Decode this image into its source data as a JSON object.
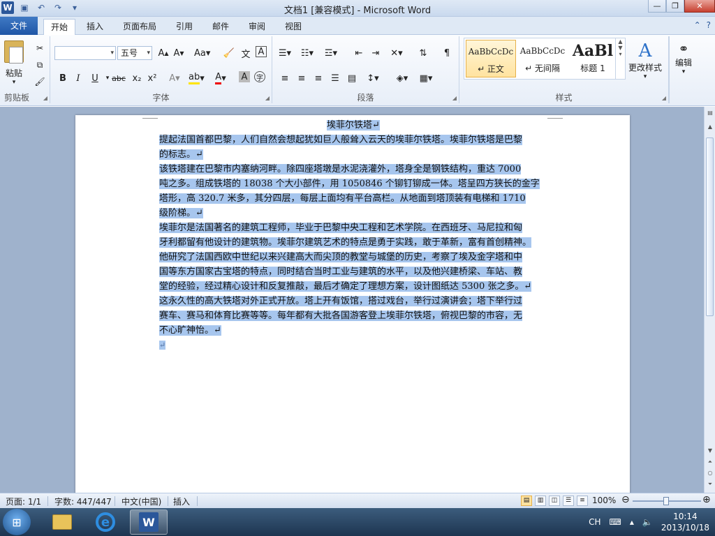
{
  "window": {
    "title": "文档1 [兼容模式] - Microsoft Word",
    "app_letter": "W"
  },
  "ribbon_tabs": [
    "文件",
    "开始",
    "插入",
    "页面布局",
    "引用",
    "邮件",
    "审阅",
    "视图"
  ],
  "ribbon": {
    "clipboard": {
      "paste_label": "粘贴",
      "group_label": "剪贴板"
    },
    "font": {
      "font_name": "",
      "font_size": "五号",
      "group_label": "字体",
      "bold": "B",
      "italic": "I",
      "underline": "U",
      "strikethrough": "abc",
      "subscript": "x₂",
      "superscript": "x²"
    },
    "paragraph": {
      "group_label": "段落"
    },
    "styles": {
      "group_label": "样式",
      "items": [
        {
          "sample": "AaBbCcDc",
          "name": "↵ 正文"
        },
        {
          "sample": "AaBbCcDc",
          "name": "↵ 无间隔"
        },
        {
          "sample": "AaBl",
          "name": "标题 1"
        }
      ],
      "change_styles_label": "更改样式"
    },
    "editing": {
      "label": "编辑"
    }
  },
  "document": {
    "lines": [
      "埃菲尔铁塔↵",
      "提起法国首都巴黎，人们自然会想起犹如巨人般耸入云天的埃菲尔铁塔。埃菲尔铁塔是巴黎",
      "的标志。↵",
      "该铁塔建在巴黎市内塞纳河畔。除四座塔墩是水泥浇灌外，塔身全是钢铁结构，重达 7000",
      "吨之多。组成铁塔的 18038 个大小部件，用 1050846 个铆钉铆成一体。塔呈四方狭长的金字",
      "塔形，高 320.7 米多，其分四层，每层上面均有平台高栏。从地面到塔顶装有电梯和 1710",
      "级阶梯。↵",
      "埃菲尔是法国著名的建筑工程师，毕业于巴黎中央工程和艺术学院。在西班牙、马尼拉和匈",
      "牙利都留有他设计的建筑物。埃菲尔建筑艺术的特点是勇于实践，敢于革新，富有首创精神。",
      "他研究了法国西欧中世纪以来兴建高大而尖顶的教堂与城堡的历史，考察了埃及金字塔和中",
      "国等东方国家古宝塔的特点，同时结合当时工业与建筑的水平，以及他兴建桥梁、车站、教",
      "堂的经验，经过精心设计和反复推敲，最后才确定了理想方案，设计图纸达 5300 张之多。↵",
      "这永久性的高大铁塔对外正式开放。塔上开有饭馆，搭过戏台，举行过演讲会；塔下举行过",
      "赛车、赛马和体育比赛等等。每年都有大批各国游客登上埃菲尔铁塔，俯视巴黎的市容，无",
      "不心旷神怡。↵",
      "↵"
    ]
  },
  "status": {
    "page": "页面: 1/1",
    "words": "字数: 447/447",
    "language": "中文(中国)",
    "insert": "插入",
    "zoom": "100%"
  },
  "taskbar": {
    "lang": "CH",
    "time": "10:14",
    "date": "2013/10/18"
  },
  "colors": {
    "selection": "#a7c6ee",
    "word_blue": "#2b579a",
    "file_tab": "#2a64b4"
  }
}
